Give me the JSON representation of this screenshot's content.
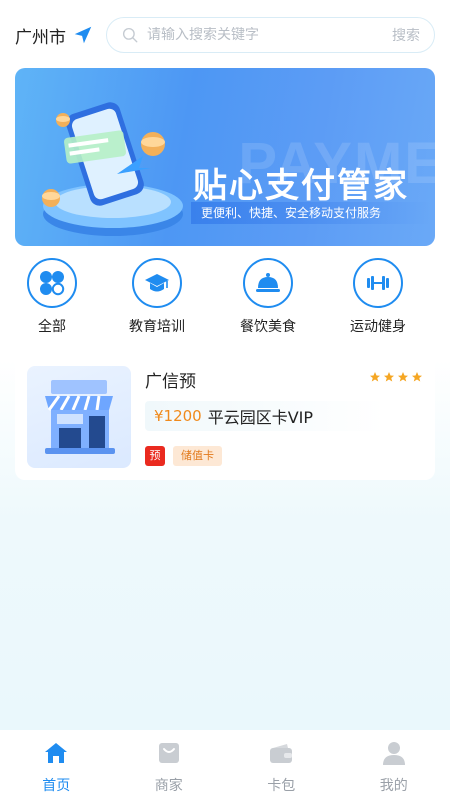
{
  "header": {
    "city": "广州市",
    "search_placeholder": "请输入搜索关键字",
    "search_button": "搜索"
  },
  "banner": {
    "title": "贴心支付管家",
    "subtitle": "更便利、快捷、安全移动支付服务",
    "watermark": "PAYME"
  },
  "categories": [
    {
      "label": "全部",
      "icon": "grid-icon"
    },
    {
      "label": "教育培训",
      "icon": "graduation-cap-icon"
    },
    {
      "label": "餐饮美食",
      "icon": "food-cloche-icon"
    },
    {
      "label": "运动健身",
      "icon": "dumbbell-icon"
    }
  ],
  "merchant": {
    "name": "广信预",
    "rating": 4,
    "price": "¥1200",
    "product": "平云园区卡VIP",
    "badge_pre": "预",
    "badge_type": "储值卡"
  },
  "tabs": [
    {
      "label": "首页",
      "icon": "home-icon",
      "active": true
    },
    {
      "label": "商家",
      "icon": "shop-bag-icon",
      "active": false
    },
    {
      "label": "卡包",
      "icon": "wallet-icon",
      "active": false
    },
    {
      "label": "我的",
      "icon": "user-icon",
      "active": false
    }
  ],
  "colors": {
    "accent": "#1f8cf0",
    "price": "#f08a1c",
    "star": "#f5a623",
    "badge_pre": "#ea2a1f"
  }
}
